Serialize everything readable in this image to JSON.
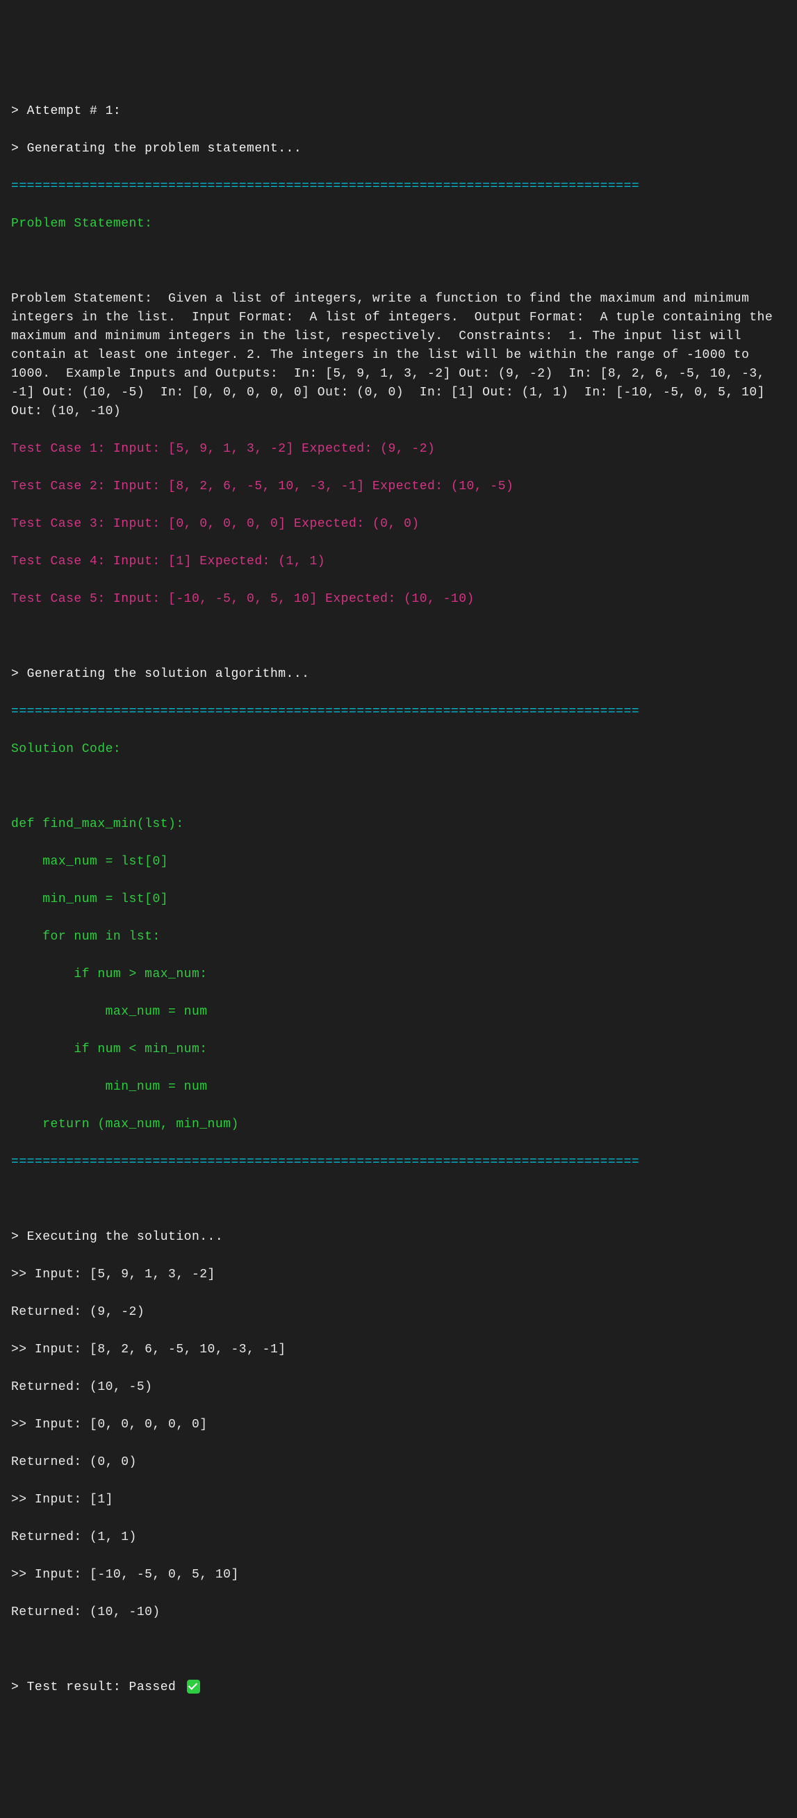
{
  "attempt_line": "> Attempt # 1:",
  "generating_problem": "> Generating the problem statement...",
  "divider": "================================================================================",
  "problem_statement_header": "Problem Statement:",
  "problem_body": "Problem Statement:  Given a list of integers, write a function to find the maximum and minimum integers in the list.  Input Format:  A list of integers.  Output Format:  A tuple containing the maximum and minimum integers in the list, respectively.  Constraints:  1. The input list will contain at least one integer. 2. The integers in the list will be within the range of -1000 to 1000.  Example Inputs and Outputs:  In: [5, 9, 1, 3, -2] Out: (9, -2)  In: [8, 2, 6, -5, 10, -3, -1] Out: (10, -5)  In: [0, 0, 0, 0, 0] Out: (0, 0)  In: [1] Out: (1, 1)  In: [-10, -5, 0, 5, 10] Out: (10, -10)",
  "test_cases": [
    "Test Case 1: Input: [5, 9, 1, 3, -2] Expected: (9, -2)",
    "Test Case 2: Input: [8, 2, 6, -5, 10, -3, -1] Expected: (10, -5)",
    "Test Case 3: Input: [0, 0, 0, 0, 0] Expected: (0, 0)",
    "Test Case 4: Input: [1] Expected: (1, 1)",
    "Test Case 5: Input: [-10, -5, 0, 5, 10] Expected: (10, -10)"
  ],
  "generating_solution": "> Generating the solution algorithm...",
  "solution_header": "Solution Code:",
  "solution_code": [
    "def find_max_min(lst):",
    "    max_num = lst[0]",
    "    min_num = lst[0]",
    "    for num in lst:",
    "        if num > max_num:",
    "            max_num = num",
    "        if num < min_num:",
    "            min_num = num",
    "    return (max_num, min_num)"
  ],
  "executing": "> Executing the solution...",
  "execution_results": [
    ">> Input: [5, 9, 1, 3, -2]",
    "Returned: (9, -2)",
    ">> Input: [8, 2, 6, -5, 10, -3, -1]",
    "Returned: (10, -5)",
    ">> Input: [0, 0, 0, 0, 0]",
    "Returned: (0, 0)",
    ">> Input: [1]",
    "Returned: (1, 1)",
    ">> Input: [-10, -5, 0, 5, 10]",
    "Returned: (10, -10)"
  ],
  "test_result": "> Test result: Passed "
}
